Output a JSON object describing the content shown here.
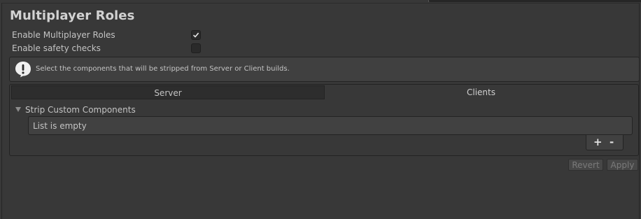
{
  "title": "Multiplayer Roles",
  "settings": {
    "enable_roles_label": "Enable Multiplayer Roles",
    "enable_roles_checked": true,
    "safety_checks_label": "Enable safety checks",
    "safety_checks_checked": false
  },
  "helpbox": {
    "icon": "warning-exclamation-icon",
    "text": "Select the components that will be stripped from Server or Client builds."
  },
  "tabs": [
    {
      "label": "Server",
      "active": false
    },
    {
      "label": "Clients",
      "active": true
    }
  ],
  "strip_section": {
    "foldout_label": "Strip Custom Components",
    "list_empty_text": "List is empty",
    "add_label": "+",
    "remove_label": "-"
  },
  "footer": {
    "revert_label": "Revert",
    "apply_label": "Apply"
  },
  "colors": {
    "background": "#383838",
    "helpbox_bg": "#404040",
    "inactive_tab": "#2d2d2d",
    "text": "#c4c4c4"
  }
}
